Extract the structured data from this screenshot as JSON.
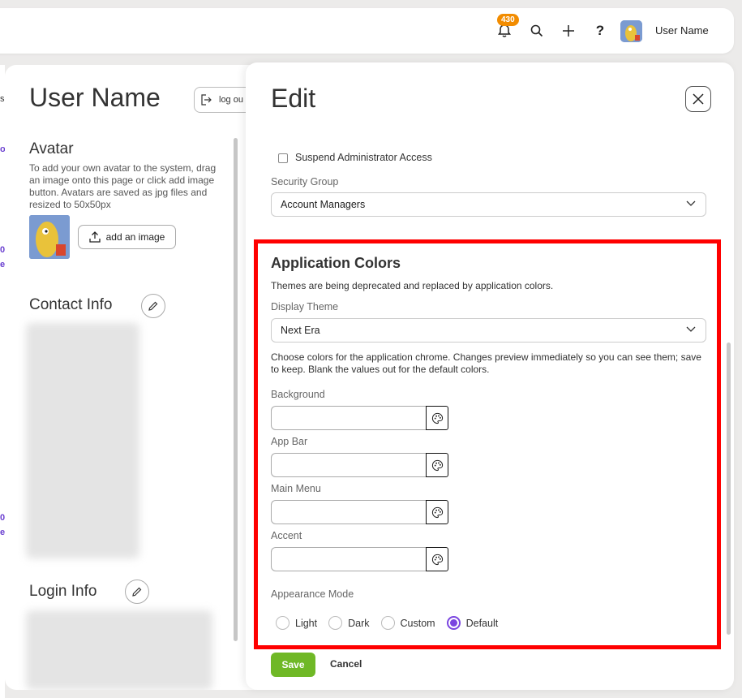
{
  "topbar": {
    "notification_count": "430",
    "username": "User Name"
  },
  "profile": {
    "name": "User Name",
    "logout_label": "log ou",
    "avatar_title": "Avatar",
    "avatar_help": "To add your own avatar to the system, drag an image onto this page or click add image button. Avatars are saved as jpg files and resized to 50x50px",
    "add_image_label": "add an image",
    "contact_title": "Contact Info",
    "login_title": "Login Info"
  },
  "modal": {
    "title": "Edit",
    "suspend_label": "Suspend Administrator Access",
    "security_group_label": "Security Group",
    "security_group_value": "Account Managers",
    "app_colors": {
      "title": "Application Colors",
      "description": "Themes are being deprecated and replaced by application colors.",
      "display_theme_label": "Display Theme",
      "display_theme_value": "Next Era",
      "help": "Choose colors for the application chrome. Changes preview immediately so you can see them; save to keep. Blank the values out for the default colors.",
      "fields": [
        {
          "label": "Background",
          "value": ""
        },
        {
          "label": "App Bar",
          "value": ""
        },
        {
          "label": "Main Menu",
          "value": ""
        },
        {
          "label": "Accent",
          "value": ""
        }
      ],
      "appearance_label": "Appearance Mode",
      "modes": [
        "Light",
        "Dark",
        "Custom",
        "Default"
      ],
      "selected_mode": "Default"
    },
    "save_label": "Save",
    "cancel_label": "Cancel"
  },
  "colors": {
    "accent": "#7a45e0",
    "save": "#6fb826",
    "badge": "#f28c00",
    "highlight": "#ff0000"
  }
}
